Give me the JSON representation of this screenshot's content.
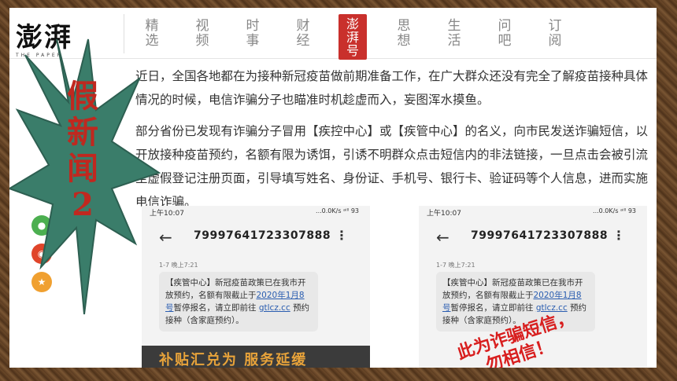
{
  "logo": {
    "name": "澎湃",
    "subtitle": "THE PAPER"
  },
  "nav": {
    "items": [
      {
        "label": "精\n选"
      },
      {
        "label": "视\n频"
      },
      {
        "label": "时\n事"
      },
      {
        "label": "财\n经"
      },
      {
        "label": "澎\n湃\n号",
        "active": true
      },
      {
        "label": "思\n想"
      },
      {
        "label": "生\n活"
      },
      {
        "label": "问\n吧"
      },
      {
        "label": "订\n阅"
      }
    ]
  },
  "article": {
    "p1": "近日，全国各地都在为接种新冠疫苗做前期准备工作，在广大群众还没有完全了解疫苗接种具体情况的时候，电信诈骗分子也瞄准时机趁虚而入，妄图浑水摸鱼。",
    "p2": "部分省份已发现有诈骗分子冒用【疾控中心】或【疾管中心】的名义，向市民发送诈骗短信，以开放接种疫苗预约，名额有限为诱饵，引诱不明群众点击短信内的非法链接，一旦点击会被引流至虚假登记注册页面，引导填写姓名、身份证、手机号、银行卡、验证码等个人信息，进而实施电信诈骗。"
  },
  "phone1": {
    "time": "上午10:07",
    "status": "...0.0K/s ᵃⁱˡˡ 93",
    "number": "79997641723307888",
    "timestamp": "1-7 晚上7:21",
    "msg_a": "【疾管中心】新冠疫苗政策已在我市开放预约，名额有限截止于",
    "msg_date": "2020年1月8号",
    "msg_b": "暂停报名，请立即前往",
    "msg_link": "gtlcz.cc",
    "msg_c": "预约接种（含家庭预约）。",
    "footer": "补贴汇兑为 服务延缓"
  },
  "phone2": {
    "time": "上午10:07",
    "status": "...0.0K/s ᵃⁱˡˡ 93",
    "number": "79997641723307888",
    "timestamp": "1-7 晚上7:21",
    "msg_a": "【疾管中心】新冠疫苗政策已在我市开放预约，名额有限截止于",
    "msg_date": "2020年1月8号",
    "msg_b": "暂停报名，请立即前往",
    "msg_link": "gtlcz.cc",
    "msg_c": "预约接种（含家庭预约）。",
    "stamp_1": "此为诈骗短信，",
    "stamp_2": "勿相信！"
  },
  "badge": {
    "text": "假\n新\n闻\n2",
    "color": "#3a7d6a"
  },
  "side_icons": [
    "wechat-icon",
    "weibo-icon",
    "qzone-icon"
  ]
}
